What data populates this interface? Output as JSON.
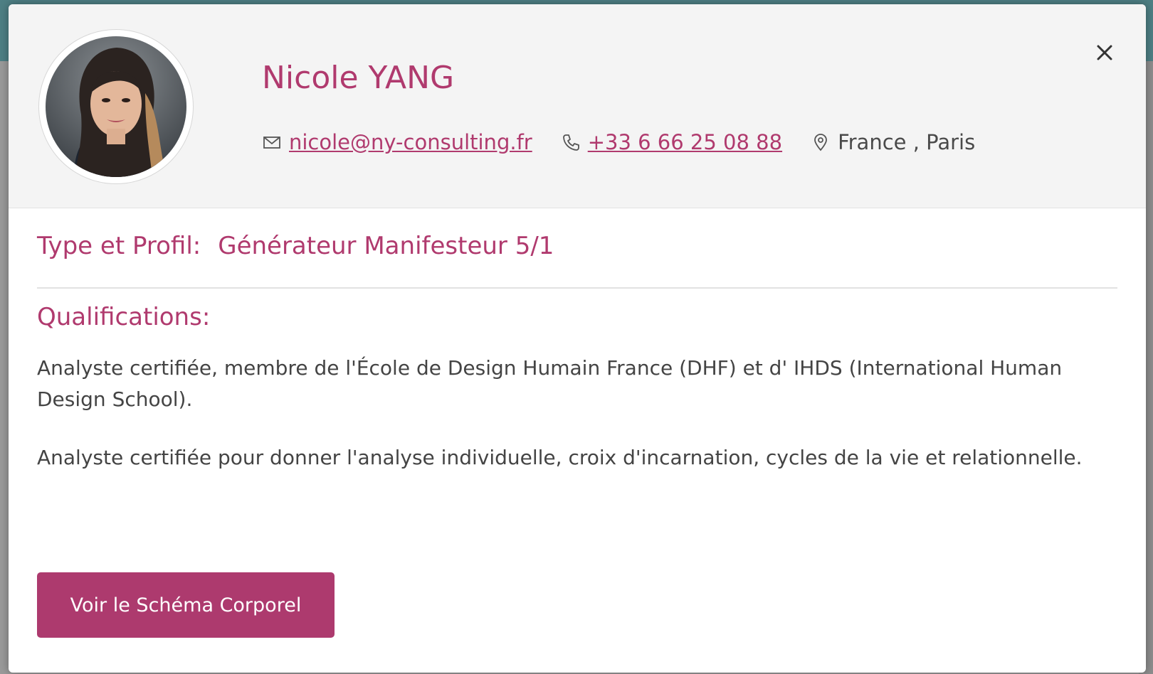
{
  "profile": {
    "name": "Nicole YANG",
    "email": "nicole@ny-consulting.fr",
    "phone": "+33 6 66 25 08 88",
    "location": "France , Paris"
  },
  "type_section": {
    "label": "Type et Profil:",
    "value": "Générateur Manifesteur 5/1"
  },
  "qualifications": {
    "heading": "Qualifications:",
    "paragraphs": [
      "Analyste certifiée, membre de l'École de Design Humain France (DHF) et d' IHDS (International Human Design School).",
      "Analyste certifiée pour donner l'analyse individuelle, croix d'incarnation, cycles de la vie et relationnelle."
    ]
  },
  "actions": {
    "body_chart_button": "Voir le Schéma Corporel"
  },
  "icons": {
    "close": "close-icon",
    "email": "envelope-icon",
    "phone": "phone-icon",
    "location": "map-pin-icon"
  },
  "colors": {
    "accent": "#b03a6e",
    "button": "#ad3a6e",
    "header_bg": "#f4f4f4",
    "text": "#444444"
  }
}
